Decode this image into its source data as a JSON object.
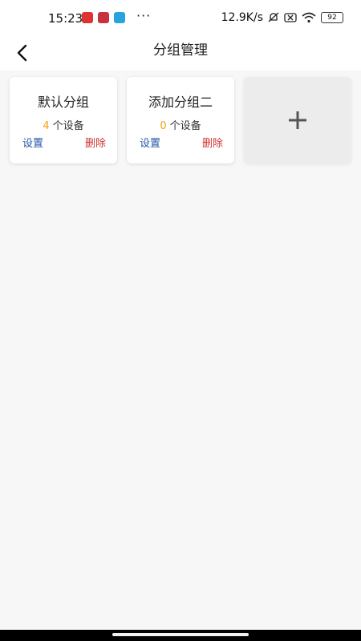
{
  "status_bar": {
    "time": "15:23",
    "network_speed": "12.9K/s",
    "battery": "92",
    "dots": "···"
  },
  "header": {
    "title": "分组管理"
  },
  "groups": [
    {
      "name": "默认分组",
      "count": "4",
      "count_unit": "个设备",
      "settings_label": "设置",
      "delete_label": "删除"
    },
    {
      "name": "添加分组二",
      "count": "0",
      "count_unit": "个设备",
      "settings_label": "设置",
      "delete_label": "删除"
    }
  ],
  "colors": {
    "count_accent": "#f2a20d",
    "settings_link": "#2456a6",
    "delete_link": "#d03131"
  }
}
